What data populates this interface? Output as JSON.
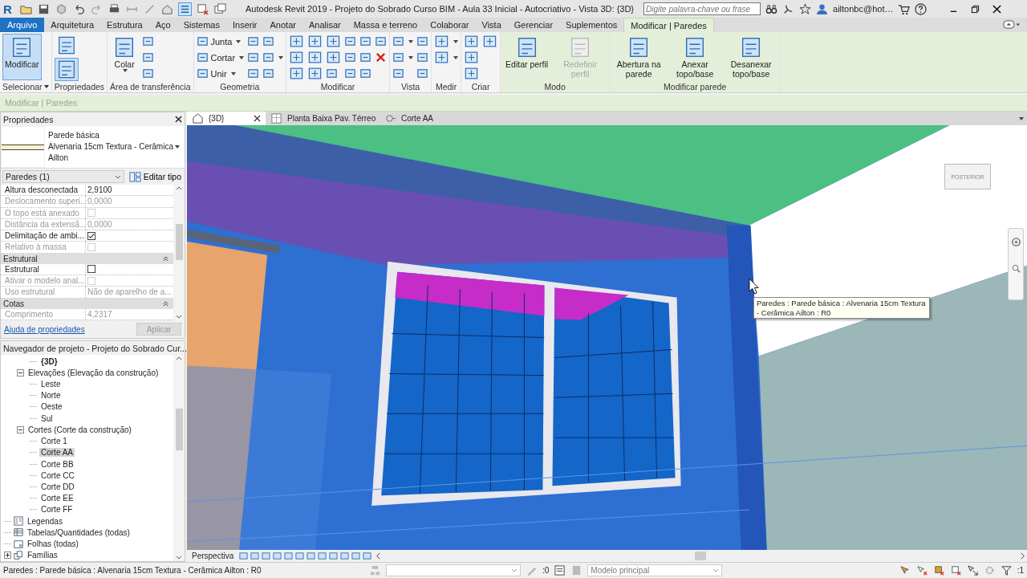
{
  "title_bar": {
    "logo": "R",
    "title": "Autodesk Revit 2019 - Projeto do Sobrado Curso BIM - Aula 33 Inicial - Autocriativo - Vista 3D: {3D}",
    "search": {
      "placeholder": "Digite palavra-chave ou frase"
    },
    "user": "ailtonbc@hot…"
  },
  "ribbon_tabs": [
    {
      "label": "Arquivo",
      "kind": "file",
      "selected": false
    },
    {
      "label": "Arquitetura",
      "kind": "tab",
      "selected": false
    },
    {
      "label": "Estrutura",
      "kind": "tab",
      "selected": false
    },
    {
      "label": "Aço",
      "kind": "tab",
      "selected": false
    },
    {
      "label": "Sistemas",
      "kind": "tab",
      "selected": false
    },
    {
      "label": "Inserir",
      "kind": "tab",
      "selected": false
    },
    {
      "label": "Anotar",
      "kind": "tab",
      "selected": false
    },
    {
      "label": "Analisar",
      "kind": "tab",
      "selected": false
    },
    {
      "label": "Massa e terreno",
      "kind": "tab",
      "selected": false
    },
    {
      "label": "Colaborar",
      "kind": "tab",
      "selected": false
    },
    {
      "label": "Vista",
      "kind": "tab",
      "selected": false
    },
    {
      "label": "Gerenciar",
      "kind": "tab",
      "selected": false
    },
    {
      "label": "Suplementos",
      "kind": "tab",
      "selected": false
    },
    {
      "label": "Modificar | Paredes",
      "kind": "contextual",
      "selected": true
    }
  ],
  "ribbon_panels": [
    {
      "label": "Selecionar",
      "dropdown": true,
      "contextual": false,
      "tools": [
        {
          "kind": "large",
          "label": "Modificar",
          "selected": true
        }
      ]
    },
    {
      "label": "Propriedades",
      "contextual": false,
      "stacked": true,
      "tools": [
        {
          "kind": "large",
          "selected": false
        },
        {
          "kind": "large",
          "selected": true
        }
      ]
    },
    {
      "label": "Área de transferência",
      "contextual": false,
      "tools": [
        {
          "kind": "large",
          "label": "Colar",
          "dropdown": true
        },
        {
          "kind": "icon"
        },
        {
          "kind": "icon"
        },
        {
          "kind": "icon"
        }
      ]
    },
    {
      "label": "Geometria",
      "contextual": false,
      "tools": [
        {
          "kind": "small",
          "label": "Junta",
          "dropdown": true
        },
        {
          "kind": "small",
          "label": "Cortar",
          "dropdown": true
        },
        {
          "kind": "small",
          "label": "Unir",
          "dropdown": true
        },
        {
          "kind": "icon"
        },
        {
          "kind": "icon"
        },
        {
          "kind": "icon"
        },
        {
          "kind": "icon"
        },
        {
          "kind": "icon",
          "dropdown": true
        },
        {
          "kind": "icon"
        }
      ]
    },
    {
      "label": "Modificar",
      "contextual": false,
      "tools": [
        {
          "kind": "medium"
        },
        {
          "kind": "medium"
        },
        {
          "kind": "medium"
        },
        {
          "kind": "medium"
        },
        {
          "kind": "medium"
        },
        {
          "kind": "medium"
        },
        {
          "kind": "medium"
        },
        {
          "kind": "medium"
        },
        {
          "kind": "icon"
        },
        {
          "kind": "icon"
        },
        {
          "kind": "icon"
        },
        {
          "kind": "icon"
        },
        {
          "kind": "icon"
        },
        {
          "kind": "icon"
        },
        {
          "kind": "icon"
        },
        {
          "kind": "icon"
        },
        {
          "kind": "delete"
        }
      ]
    },
    {
      "label": "Vista",
      "contextual": false,
      "tools": [
        {
          "kind": "icon",
          "dropdown": true
        },
        {
          "kind": "icon",
          "dropdown": true
        },
        {
          "kind": "icon"
        },
        {
          "kind": "icon"
        },
        {
          "kind": "icon"
        },
        {
          "kind": "icon"
        }
      ]
    },
    {
      "label": "Medir",
      "contextual": false,
      "tools": [
        {
          "kind": "medium",
          "dropdown": true
        },
        {
          "kind": "medium",
          "dropdown": true
        }
      ]
    },
    {
      "label": "Criar",
      "contextual": false,
      "tools": [
        {
          "kind": "medium"
        },
        {
          "kind": "medium"
        },
        {
          "kind": "medium"
        },
        {
          "kind": "medium"
        }
      ]
    },
    {
      "label": "Modo",
      "contextual": true,
      "tools": [
        {
          "kind": "large",
          "label": "Editar perfil",
          "disabled": false
        },
        {
          "kind": "large",
          "label": "Redefinir perfil",
          "disabled": true
        }
      ]
    },
    {
      "label": "Modificar parede",
      "contextual": true,
      "tools": [
        {
          "kind": "large",
          "label": "Abertura na parede"
        },
        {
          "kind": "large",
          "label": "Anexar topo/base"
        },
        {
          "kind": "large",
          "label": "Desanexar topo/base"
        }
      ]
    }
  ],
  "options_bar": {
    "label": "Modificar | Paredes"
  },
  "properties": {
    "title": "Propriedades",
    "type_lines": [
      "Parede básica",
      "Alvenaria 15cm Textura - Cerâmica",
      "Ailton"
    ],
    "filter": "Paredes (1)",
    "edit_type": "Editar tipo",
    "rows": [
      {
        "kind": "param",
        "name": "Altura desconectada",
        "value": "2,9100",
        "disabled": false
      },
      {
        "kind": "param",
        "name": "Deslocamento superi...",
        "value": "0,0000",
        "disabled": true
      },
      {
        "kind": "check",
        "name": "O topo está anexado",
        "checked": false,
        "disabled": true
      },
      {
        "kind": "param",
        "name": "Distância da extensã...",
        "value": "0,0000",
        "disabled": true
      },
      {
        "kind": "check",
        "name": "Delimitação de ambi...",
        "checked": true,
        "disabled": false
      },
      {
        "kind": "check",
        "name": "Relativo à massa",
        "checked": false,
        "disabled": true
      },
      {
        "kind": "group",
        "name": "Estrutural"
      },
      {
        "kind": "check",
        "name": "Estrutural",
        "checked": false,
        "disabled": false
      },
      {
        "kind": "check",
        "name": "Ativar o modelo anal...",
        "checked": false,
        "disabled": true
      },
      {
        "kind": "param",
        "name": "Uso estrutural",
        "value": "Não de aparelho de a...",
        "disabled": true
      },
      {
        "kind": "group",
        "name": "Cotas"
      },
      {
        "kind": "param",
        "name": "Comprimento",
        "value": "4,2317",
        "disabled": true
      }
    ],
    "help_link": "Ajuda de propriedades",
    "apply": "Aplicar"
  },
  "project_browser": {
    "title": "Navegador de projeto - Projeto do Sobrado Cur...",
    "items": [
      {
        "children": [
          {
            "children": [
              {
                "label": "{3D}",
                "selected": false,
                "current": true
              }
            ]
          },
          {
            "label": "Elevações (Elevação da construção)",
            "expanded": true,
            "selected": false,
            "children": [
              {
                "label": "Leste",
                "selected": false
              },
              {
                "label": "Norte",
                "selected": false
              },
              {
                "label": "Oeste",
                "selected": false
              },
              {
                "label": "Sul",
                "selected": false
              }
            ]
          },
          {
            "label": "Cortes (Corte da construção)",
            "expanded": true,
            "selected": false,
            "children": [
              {
                "label": "Corte 1",
                "selected": false
              },
              {
                "label": "Corte AA",
                "selected": true
              },
              {
                "label": "Corte BB",
                "selected": false
              },
              {
                "label": "Corte CC",
                "selected": false
              },
              {
                "label": "Corte DD",
                "selected": false
              },
              {
                "label": "Corte EE",
                "selected": false
              },
              {
                "label": "Corte FF",
                "selected": false
              }
            ]
          }
        ]
      },
      {
        "label": "Legendas",
        "kind": "legend",
        "selected": false
      },
      {
        "label": "Tabelas/Quantidades (todas)",
        "kind": "schedule",
        "selected": false
      },
      {
        "label": "Folhas (todas)",
        "kind": "sheet",
        "selected": false
      },
      {
        "label": "Famílias",
        "kind": "family",
        "expanded": false,
        "selected": false
      }
    ]
  },
  "view_tabs": [
    {
      "label": "{3D}",
      "kind": "model",
      "selected": true
    },
    {
      "label": "Planta Baixa Pav. Térreo",
      "kind": "plan",
      "selected": false
    },
    {
      "label": "Corte AA",
      "kind": "section",
      "selected": false
    }
  ],
  "view": {
    "view_cube": "POSTERIOR",
    "tooltip": "Paredes : Parede básica : Alvenaria 15cm Textura - Cerâmica  Ailton : R0"
  },
  "view_bar": {
    "label": "Perspectiva"
  },
  "status_bar": {
    "text": "Paredes : Parede básica : Alvenaria 15cm Textura - Cerâmica  Ailton : R0",
    "workset_count": ":0",
    "model": "Modelo principal",
    "filter_count": ":1"
  }
}
